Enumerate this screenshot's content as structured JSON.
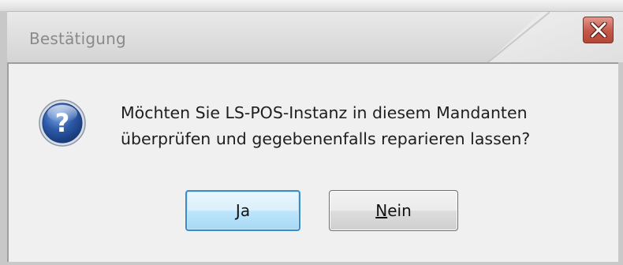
{
  "dialog": {
    "title": "Bestätigung",
    "close_icon": "close-icon",
    "message_lines": [
      "Möchten Sie LS-POS-Instanz in diesem Mandanten",
      "überprüfen und gegebenenfalls reparieren lassen?"
    ],
    "message_icon": "question-icon",
    "buttons": {
      "yes": {
        "accel": "J",
        "rest": "a"
      },
      "no": {
        "accel": "N",
        "rest": "ein"
      }
    }
  },
  "colors": {
    "close_button": "#c4584a",
    "default_button_border": "#3c8ccb",
    "question_icon": "#2d5aa8"
  }
}
